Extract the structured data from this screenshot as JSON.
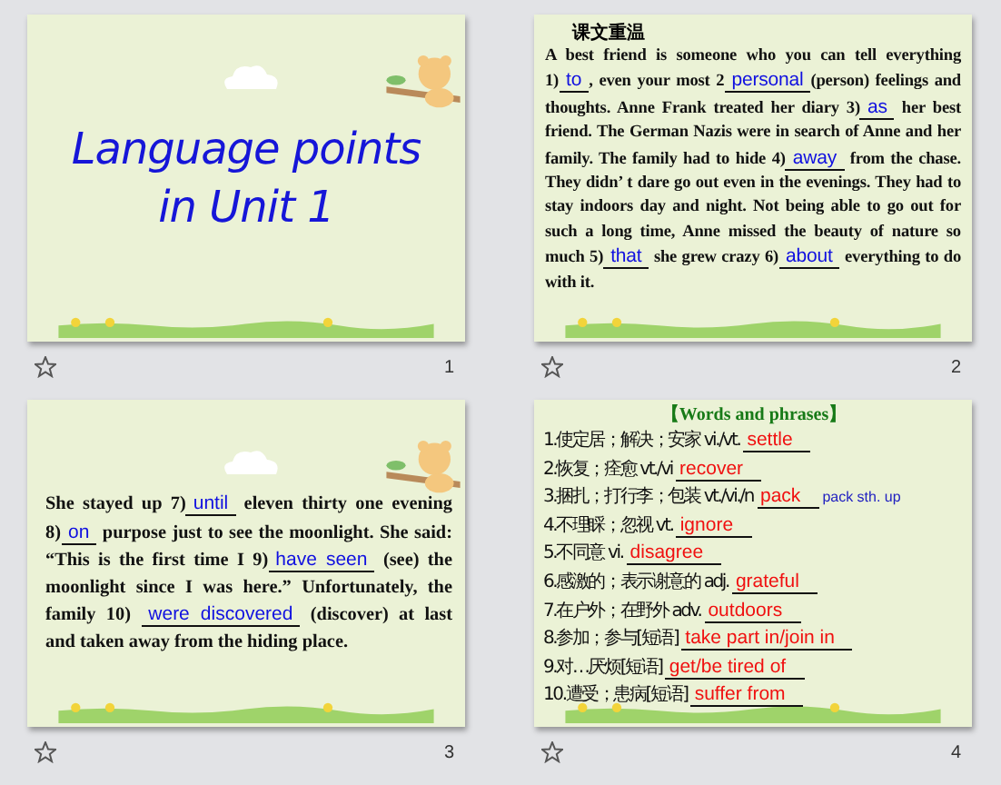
{
  "slides": [
    {
      "number": "1",
      "kind": "title",
      "title_lines": [
        "Language points",
        "in Unit 1"
      ]
    },
    {
      "number": "2",
      "kind": "passage",
      "heading": "课文重温",
      "passage": [
        {
          "kind": "plain",
          "text": "A best friend is someone who you can tell everything 1)"
        },
        {
          "kind": "answer",
          "text": "to"
        },
        {
          "kind": "plain",
          "text": ", even your most 2"
        },
        {
          "kind": "answer",
          "text": "personal"
        },
        {
          "kind": "plain",
          "text": "(person) feelings and thoughts. Anne Frank treated her diary 3)"
        },
        {
          "kind": "answer",
          "text": "as"
        },
        {
          "kind": "plain",
          "text": " her best friend. The German Nazis were in search of Anne and her family. The family had to hide 4)"
        },
        {
          "kind": "answer",
          "text": "away"
        },
        {
          "kind": "plain",
          "text": " from the chase. They didn’ t dare go out even in the evenings. They had to stay indoors day and night. Not being able to go out for such a long time, Anne missed the beauty of nature so much 5)"
        },
        {
          "kind": "answer",
          "text": "that"
        },
        {
          "kind": "plain",
          "text": " she grew crazy 6)"
        },
        {
          "kind": "answer",
          "text": "about"
        },
        {
          "kind": "plain",
          "text": " everything to do with it."
        }
      ]
    },
    {
      "number": "3",
      "kind": "passage",
      "passage": [
        {
          "kind": "plain",
          "text": "She stayed up 7)"
        },
        {
          "kind": "answer",
          "text": "until"
        },
        {
          "kind": "plain",
          "text": " eleven thirty one evening 8)"
        },
        {
          "kind": "answer",
          "text": "on"
        },
        {
          "kind": "plain",
          "text": " purpose just to see the moonlight. She said: “This is the first time I 9)"
        },
        {
          "kind": "answer",
          "text": "have seen"
        },
        {
          "kind": "plain",
          "text": " (see) the moonlight since I was here.” Unfortunately, the family 10) "
        },
        {
          "kind": "answer",
          "text": "were discovered"
        },
        {
          "kind": "plain",
          "text": " (discover) at last and taken away from the hiding place."
        }
      ]
    },
    {
      "number": "4",
      "kind": "vocabulary",
      "heading": "【Words and phrases】",
      "items": [
        {
          "prompt": "1.使定居；解决；安家 vi./vt.",
          "answer": "settle"
        },
        {
          "prompt": "2.恢复；痊愈 vt./vi",
          "answer": "recover"
        },
        {
          "prompt": "3.捆扎；打行李；包装 vt./vi./n",
          "answer": "pack",
          "note": "pack sth. up"
        },
        {
          "prompt": "4.不理睬；忽视 vt.",
          "answer": "ignore"
        },
        {
          "prompt": "5.不同意 vi.",
          "answer": "disagree"
        },
        {
          "prompt": "6.感激的；表示谢意的 adj.",
          "answer": "grateful"
        },
        {
          "prompt": "7.在户外；在野外 adv.",
          "answer": "outdoors"
        },
        {
          "prompt": "8.参加；参与[短语]",
          "answer": "take part in/join in"
        },
        {
          "prompt": "9.对…厌烦[短语]",
          "answer": "get/be tired of"
        },
        {
          "prompt": "10.遭受；患病[短语]",
          "answer": "suffer from"
        }
      ]
    }
  ]
}
